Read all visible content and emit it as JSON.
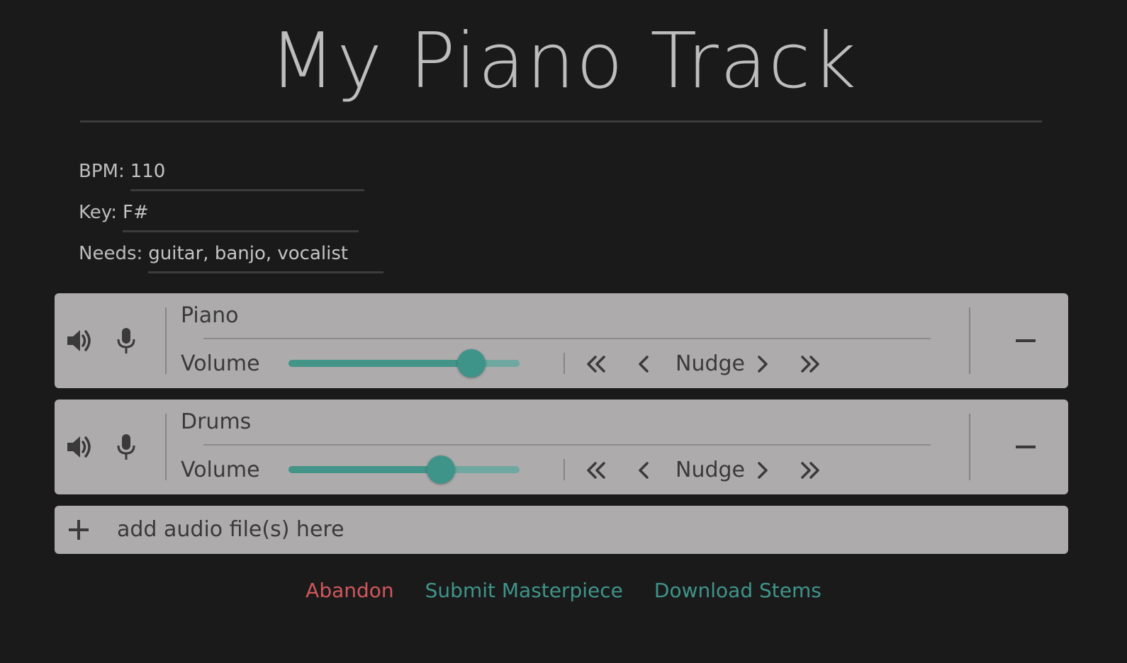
{
  "page": {
    "title": "My Piano Track"
  },
  "meta": {
    "bpm": {
      "label": "BPM:",
      "value": "110"
    },
    "key": {
      "label": "Key:",
      "value": "F#"
    },
    "needs": {
      "label": "Needs:",
      "value": "guitar, banjo, vocalist"
    }
  },
  "tracks": [
    {
      "name": "Piano",
      "volume_label": "Volume",
      "volume": 0.79,
      "nudge_label": "Nudge"
    },
    {
      "name": "Drums",
      "volume_label": "Volume",
      "volume": 0.66,
      "nudge_label": "Nudge"
    }
  ],
  "add_audio": {
    "label": "add audio file(s) here"
  },
  "actions": {
    "abandon": "Abandon",
    "submit": "Submit Masterpiece",
    "download": "Download Stems"
  },
  "colors": {
    "background": "#1a1a1b",
    "panel": "#adabac",
    "accent": "#3f9489",
    "danger": "#d0575a"
  },
  "icons": {
    "speaker": "speaker-icon",
    "mic": "microphone-icon",
    "skip_back": "double-chevron-left-icon",
    "step_back": "chevron-left-icon",
    "step_forward": "chevron-right-icon",
    "skip_forward": "double-chevron-right-icon",
    "remove": "minus-icon",
    "add": "plus-icon"
  }
}
